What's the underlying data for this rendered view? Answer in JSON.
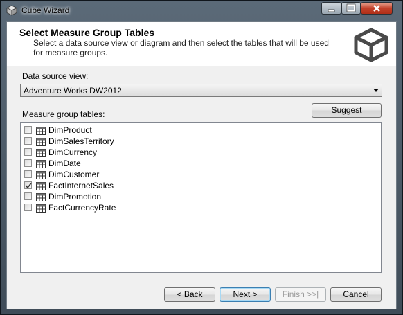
{
  "window": {
    "title": "Cube Wizard"
  },
  "header": {
    "title": "Select Measure Group Tables",
    "description": "Select a data source view or diagram and then select the tables that will be used for measure groups."
  },
  "data_source": {
    "label": "Data source view:",
    "value": "Adventure Works DW2012"
  },
  "measure_tables": {
    "label": "Measure group tables:",
    "suggest_label": "Suggest",
    "items": [
      {
        "name": "DimProduct",
        "checked": false
      },
      {
        "name": "DimSalesTerritory",
        "checked": false
      },
      {
        "name": "DimCurrency",
        "checked": false
      },
      {
        "name": "DimDate",
        "checked": false
      },
      {
        "name": "DimCustomer",
        "checked": false
      },
      {
        "name": "FactInternetSales",
        "checked": true
      },
      {
        "name": "DimPromotion",
        "checked": false
      },
      {
        "name": "FactCurrencyRate",
        "checked": false
      }
    ]
  },
  "buttons": {
    "back": "< Back",
    "next": "Next >",
    "finish": "Finish >>|",
    "cancel": "Cancel"
  }
}
